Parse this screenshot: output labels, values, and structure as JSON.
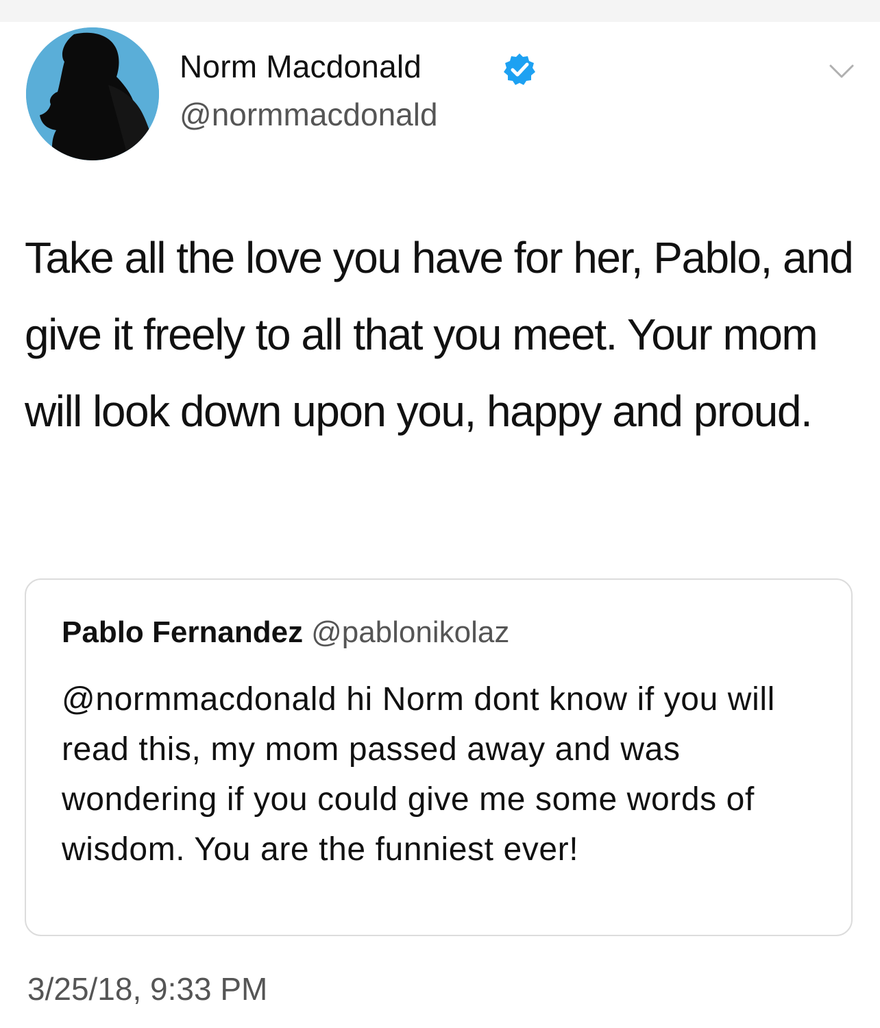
{
  "author": {
    "display_name": "Norm Macdonald",
    "handle": "@normmacdonald",
    "verified": true,
    "avatar_icon": "silhouette-avatar",
    "verified_color": "#1da1f2"
  },
  "tweet": {
    "text": "Take all the love you have for her, Pablo, and give it freely to all that you meet. Your mom will look down upon you, happy and proud.",
    "timestamp": "3/25/18, 9:33 PM"
  },
  "quoted_tweet": {
    "display_name": "Pablo Fernandez",
    "handle": "@pablonikolaz",
    "text": "@normmacdonald hi Norm dont know if you will read this, my mom passed away and was wondering if you could give me some words of wisdom. You are the funniest ever!"
  },
  "menu_icon": "chevron-down-icon"
}
